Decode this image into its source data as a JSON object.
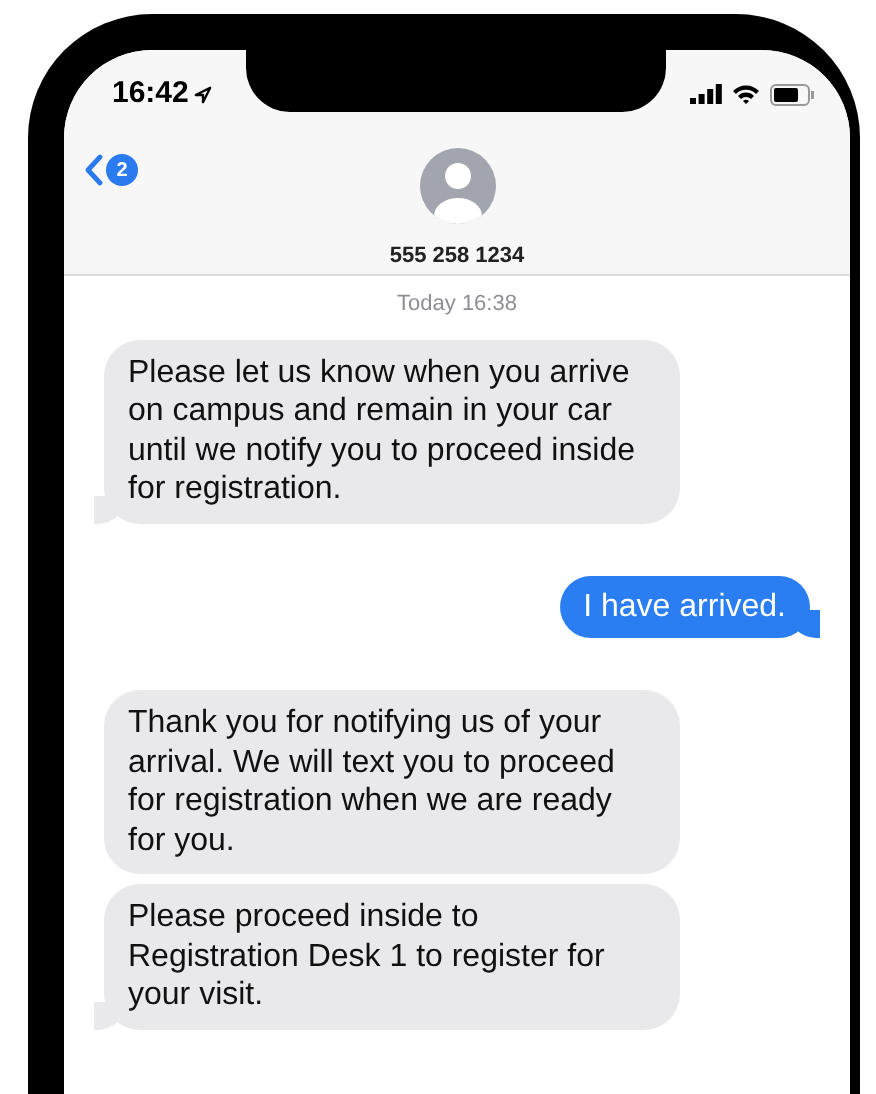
{
  "status_bar": {
    "time": "16:42"
  },
  "header": {
    "back_badge": "2",
    "contact": "555 258 1234"
  },
  "timestamp": "Today 16:38",
  "messages": [
    {
      "kind": "received",
      "tail": true,
      "text": "Please let us know when you arrive on campus and remain in your car until we notify you to proceed inside for registration."
    },
    {
      "kind": "sent",
      "tail": true,
      "text": "I have arrived."
    },
    {
      "kind": "received",
      "tail": false,
      "text": "Thank you for notifying us of your arrival. We will text you to proceed for registration when we are ready for you."
    },
    {
      "kind": "received",
      "tail": true,
      "text": "Please proceed inside to Registration Desk 1 to register for your visit."
    }
  ]
}
